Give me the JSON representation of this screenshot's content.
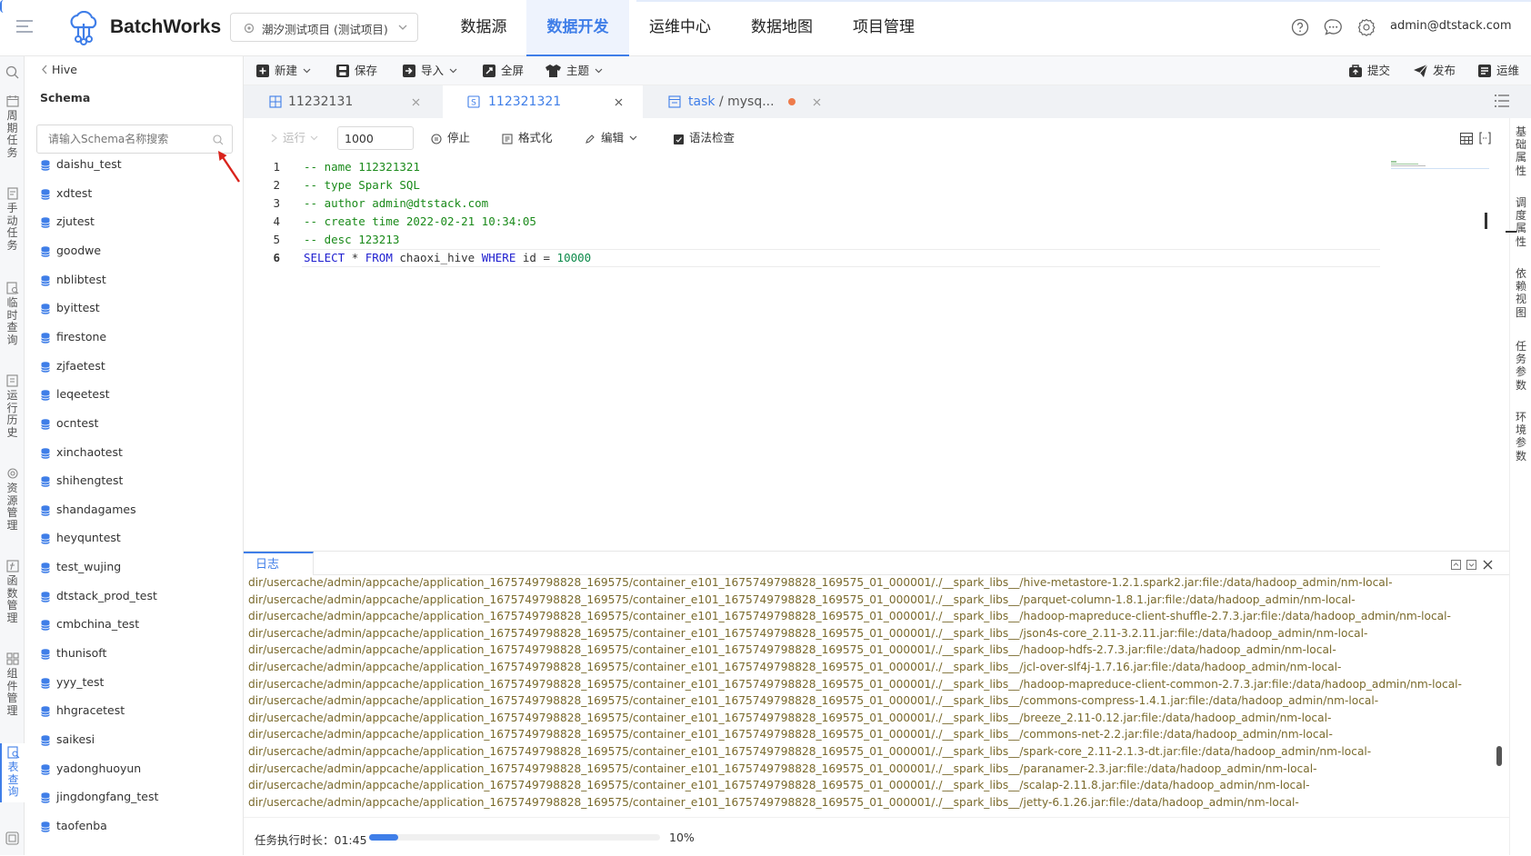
{
  "app": {
    "name": "BatchWorks",
    "project": "潮汐测试项目 (测试项目)",
    "user": "admin@dtstack.com",
    "accent": "#3f7ee8"
  },
  "nav": [
    {
      "label": "数据源",
      "active": false
    },
    {
      "label": "数据开发",
      "active": true
    },
    {
      "label": "运维中心",
      "active": false
    },
    {
      "label": "数据地图",
      "active": false
    },
    {
      "label": "项目管理",
      "active": false
    }
  ],
  "rail": [
    {
      "label": "周期任务",
      "icon": "calendar-icon"
    },
    {
      "label": "手动任务",
      "icon": "hand-task-icon"
    },
    {
      "label": "临时查询",
      "icon": "query-icon"
    },
    {
      "label": "运行历史",
      "icon": "history-icon"
    },
    {
      "label": "资源管理",
      "icon": "gear-icon"
    },
    {
      "label": "函数管理",
      "icon": "function-icon"
    },
    {
      "label": "组件管理",
      "icon": "component-icon"
    },
    {
      "label": "表查询",
      "icon": "table-search-icon"
    }
  ],
  "schema": {
    "back_label": "Hive",
    "title": "Schema",
    "search_placeholder": "请输入Schema名称搜索",
    "items": [
      "daishu_test",
      "xdtest",
      "zjutest",
      "goodwe",
      "nblibtest",
      "byittest",
      "firestone",
      "zjfaetest",
      "leqeetest",
      "ocntest",
      "xinchaotest",
      "shihengtest",
      "shandagames",
      "heyquntest",
      "test_wujing",
      "dtstack_prod_test",
      "cmbchina_test",
      "thunisoft",
      "yyy_test",
      "hhgracetest",
      "saikesi",
      "yadonghuoyun",
      "jingdongfang_test",
      "taofenba"
    ]
  },
  "toolbar": {
    "new": "新建",
    "save": "保存",
    "import": "导入",
    "fullscreen": "全屏",
    "theme": "主题",
    "submit": "提交",
    "publish": "发布",
    "ops": "运维"
  },
  "tabs": [
    {
      "label": "11232131",
      "active": false
    },
    {
      "label": "112321321",
      "active": true
    },
    {
      "label": "task",
      "suffix": "/ mysq...",
      "active": false
    }
  ],
  "editor_bar": {
    "run": "运行",
    "limit": "1000",
    "stop": "停止",
    "format": "格式化",
    "edit": "编辑",
    "check": "语法检查"
  },
  "code": {
    "lines": [
      "-- name 112321321",
      "-- type Spark SQL",
      "-- author admin@dtstack.com",
      "-- create time 2022-02-21 10:34:05",
      "-- desc 123213"
    ],
    "line6": {
      "k1": "SELECT",
      "op": "*",
      "k2": "FROM",
      "table": "chaoxi_hive",
      "k3": "WHERE",
      "col": "id",
      "eq": "=",
      "val": "10000"
    },
    "numbers": [
      "1",
      "2",
      "3",
      "4",
      "5",
      "6"
    ]
  },
  "right_tabs": [
    "基础属性",
    "调度属性",
    "依赖视图",
    "任务参数",
    "环境参数"
  ],
  "log": {
    "title": "日志",
    "lines": [
      "dir/usercache/admin/appcache/application_1675749798828_169575/container_e101_1675749798828_169575_01_000001/./__spark_libs__/hive-metastore-1.2.1.spark2.jar:file:/data/hadoop_admin/nm-local-",
      "dir/usercache/admin/appcache/application_1675749798828_169575/container_e101_1675749798828_169575_01_000001/./__spark_libs__/parquet-column-1.8.1.jar:file:/data/hadoop_admin/nm-local-",
      "dir/usercache/admin/appcache/application_1675749798828_169575/container_e101_1675749798828_169575_01_000001/./__spark_libs__/hadoop-mapreduce-client-shuffle-2.7.3.jar:file:/data/hadoop_admin/nm-local-",
      "dir/usercache/admin/appcache/application_1675749798828_169575/container_e101_1675749798828_169575_01_000001/./__spark_libs__/json4s-core_2.11-3.2.11.jar:file:/data/hadoop_admin/nm-local-",
      "dir/usercache/admin/appcache/application_1675749798828_169575/container_e101_1675749798828_169575_01_000001/./__spark_libs__/hadoop-hdfs-2.7.3.jar:file:/data/hadoop_admin/nm-local-",
      "dir/usercache/admin/appcache/application_1675749798828_169575/container_e101_1675749798828_169575_01_000001/./__spark_libs__/jcl-over-slf4j-1.7.16.jar:file:/data/hadoop_admin/nm-local-",
      "dir/usercache/admin/appcache/application_1675749798828_169575/container_e101_1675749798828_169575_01_000001/./__spark_libs__/hadoop-mapreduce-client-common-2.7.3.jar:file:/data/hadoop_admin/nm-local-",
      "dir/usercache/admin/appcache/application_1675749798828_169575/container_e101_1675749798828_169575_01_000001/./__spark_libs__/commons-compress-1.4.1.jar:file:/data/hadoop_admin/nm-local-",
      "dir/usercache/admin/appcache/application_1675749798828_169575/container_e101_1675749798828_169575_01_000001/./__spark_libs__/breeze_2.11-0.12.jar:file:/data/hadoop_admin/nm-local-",
      "dir/usercache/admin/appcache/application_1675749798828_169575/container_e101_1675749798828_169575_01_000001/./__spark_libs__/commons-net-2.2.jar:file:/data/hadoop_admin/nm-local-",
      "dir/usercache/admin/appcache/application_1675749798828_169575/container_e101_1675749798828_169575_01_000001/./__spark_libs__/spark-core_2.11-2.1.3-dt.jar:file:/data/hadoop_admin/nm-local-",
      "dir/usercache/admin/appcache/application_1675749798828_169575/container_e101_1675749798828_169575_01_000001/./__spark_libs__/paranamer-2.3.jar:file:/data/hadoop_admin/nm-local-",
      "dir/usercache/admin/appcache/application_1675749798828_169575/container_e101_1675749798828_169575_01_000001/./__spark_libs__/scalap-2.11.8.jar:file:/data/hadoop_admin/nm-local-",
      "dir/usercache/admin/appcache/application_1675749798828_169575/container_e101_1675749798828_169575_01_000001/./__spark_libs__/jetty-6.1.26.jar:file:/data/hadoop_admin/nm-local-"
    ],
    "duration_label": "任务执行时长：01:45",
    "progress_fraction": 0.1,
    "progress_text": "10%"
  }
}
